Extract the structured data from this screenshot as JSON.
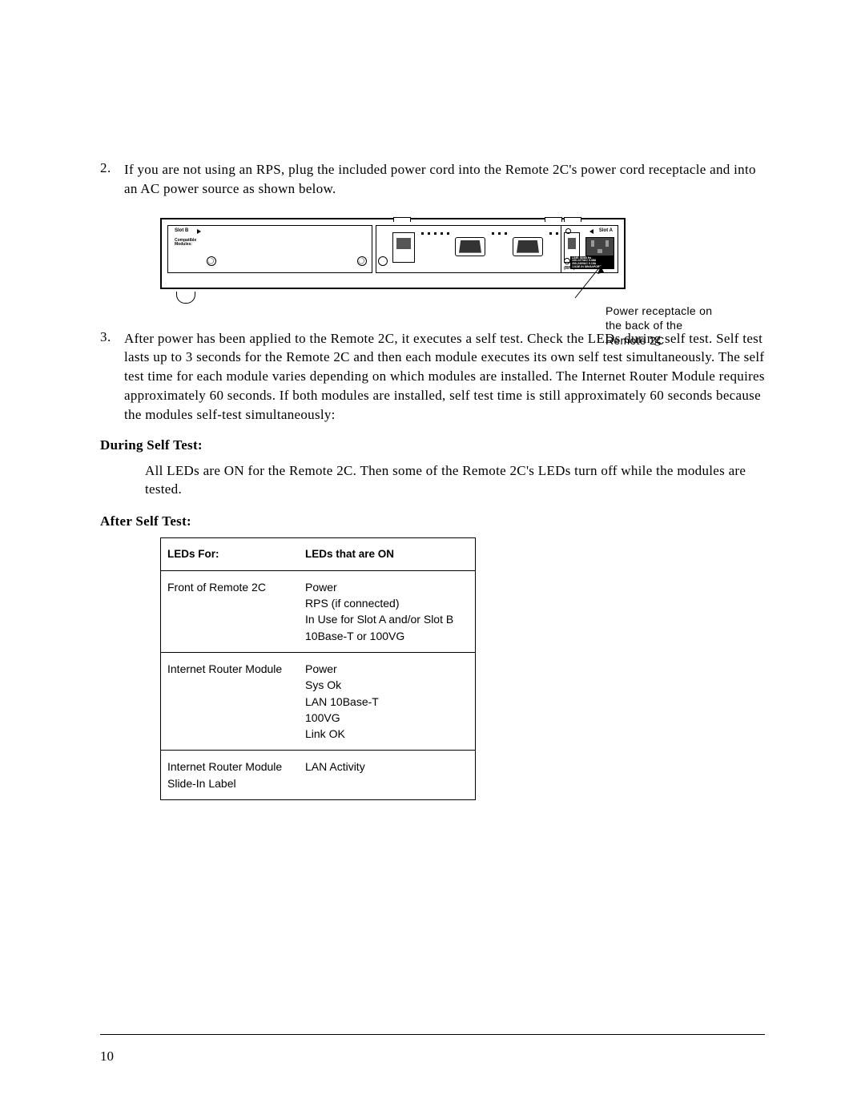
{
  "steps": {
    "step2": {
      "number": "2.",
      "text": "If you are not using an RPS, plug the included power cord into the Remote 2C's power cord receptacle and into an AC power source as shown below."
    },
    "step3": {
      "number": "3.",
      "text": "After power has been applied to the Remote 2C, it executes a self test. Check the LEDs during self test. Self test lasts up to 3 seconds for the Remote 2C and then each module executes its own self test simultaneously. The self test time for each module varies depending on which modules are installed. The Internet Router Module requires approximately 60 seconds. If both modules are installed, self test time is still approximately 60 seconds because the modules self-test simultaneously:"
    }
  },
  "figure": {
    "slot_b": "Slot B",
    "compat": "Compatible\nModules:",
    "slot_a": "Slot A",
    "rps": "(RPS)",
    "label_line1": "LINE: 50/60 Hz",
    "label_line2": "100-127VAC 0.38A",
    "label_line3": "200-240VAC 0.19A",
    "label_line4": "MADE IN SINGAPORE",
    "callout": "Power receptacle on the back of the Remote 2C"
  },
  "headings": {
    "during": "During Self Test:",
    "during_text": "All LEDs are ON for the Remote 2C. Then some of the Remote 2C's LEDs turn off while the modules are tested.",
    "after": "After Self Test:"
  },
  "table": {
    "header1": "LEDs For:",
    "header2": "LEDs that are ON",
    "rows": [
      {
        "c1": "Front of Remote 2C",
        "c2": "Power\nRPS (if connected)\nIn Use for Slot A and/or Slot B\n10Base-T or 100VG"
      },
      {
        "c1": "Internet Router Module",
        "c2": "Power\nSys Ok\nLAN 10Base-T\n100VG\nLink OK"
      },
      {
        "c1": "Internet Router Module Slide-In Label",
        "c2": "LAN Activity"
      }
    ]
  },
  "page_number": "10"
}
